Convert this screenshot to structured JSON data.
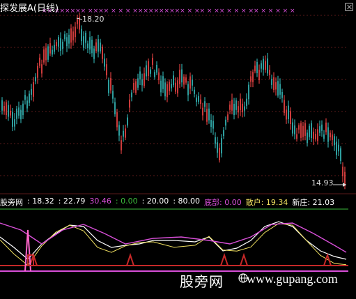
{
  "header": {
    "stock_name": "探发展A",
    "period": "(日线)"
  },
  "main_chart": {
    "high_label": "18.20",
    "low_label": "14.93",
    "x_markers": "×× ×××××× ×××× ×  × × ×××××××××× ×  ×× ×  ×× ×   ×   × ×× × × ×   ×   ×",
    "colors": {
      "up": "#ff4a4a",
      "down": "#39c6c6",
      "grid": "#5a1a1a",
      "marker": "#d84fd8"
    }
  },
  "indicator": {
    "name_label": "股旁网",
    "v1": ": 18.32",
    "v2": ": 22.79",
    "v3": "30.46",
    "v4": ": 0.00",
    "v5": ": 20.00",
    "v6": ": 80.00",
    "bottom_label": "底部: 0.00",
    "retail_label": "散户: 19.34",
    "newzhuang_label": "新庄: 21.03",
    "colors": {
      "white": "#ffffff",
      "magenta": "#d84fd8",
      "yellow": "#f0e060",
      "red": "#c62828",
      "green": "#3dbd3d",
      "pink": "#ff66cc"
    }
  },
  "watermark": {
    "site_name": "股旁网",
    "url": "www.gupang.com"
  }
}
